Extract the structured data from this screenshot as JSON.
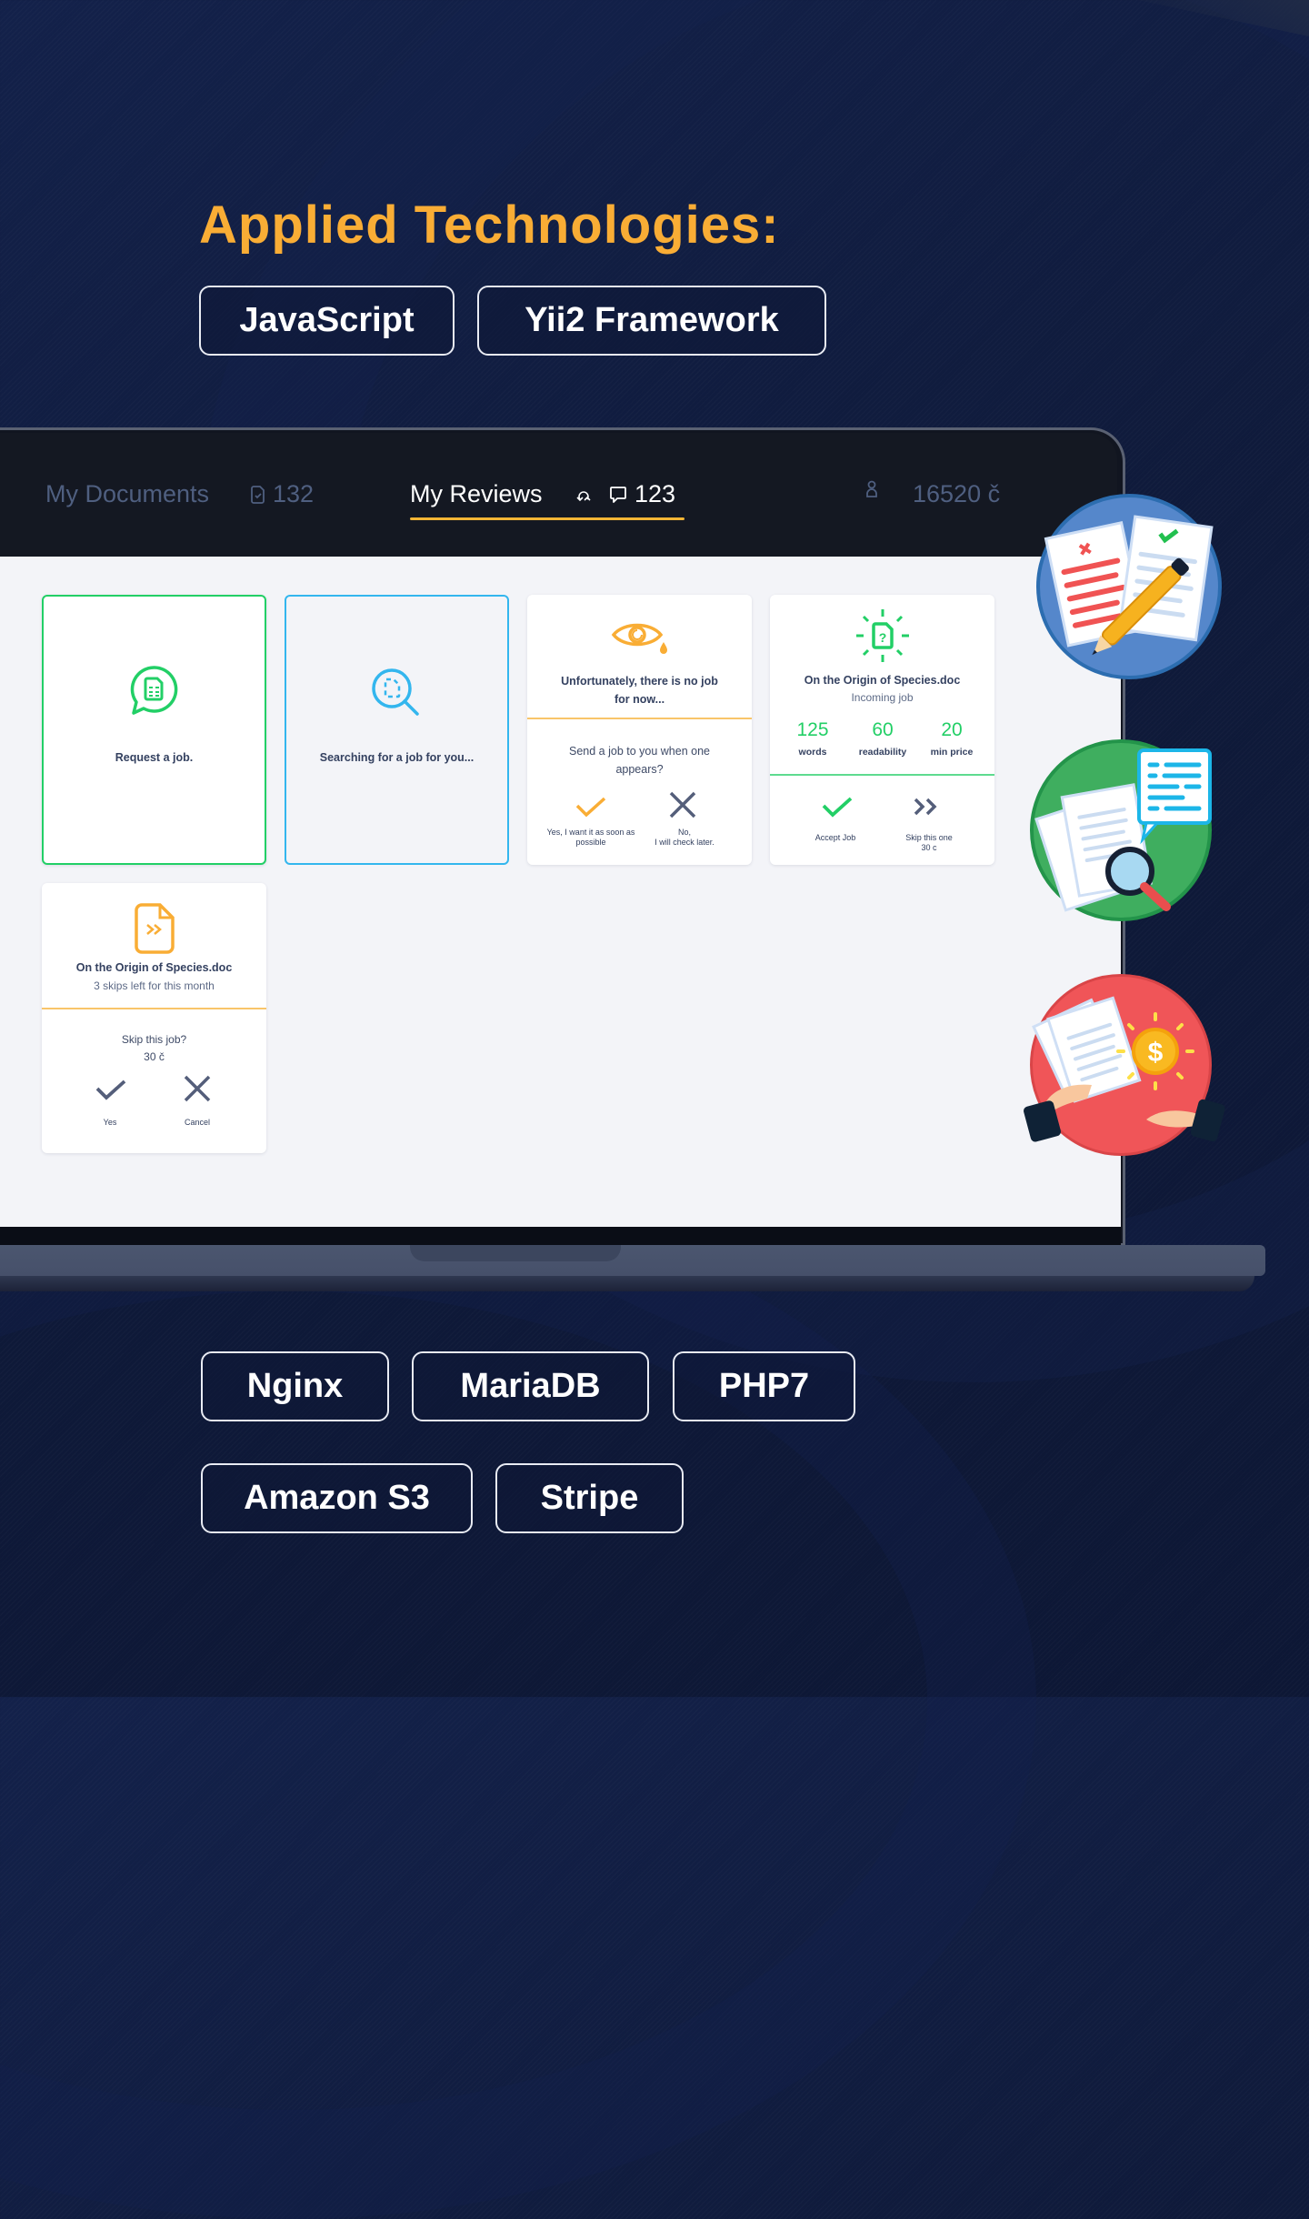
{
  "heading": "Applied Technologies:",
  "top_technologies": [
    "JavaScript",
    "Yii2 Framework"
  ],
  "bottom_technologies": [
    "Nginx",
    "MariaDB",
    "PHP7",
    "Amazon S3",
    "Stripe"
  ],
  "colors": {
    "accent_orange": "#f9ad35",
    "green": "#22cf66",
    "blue": "#33b6ee",
    "nav_underline": "#f2b535",
    "background": "#101b3a"
  },
  "app": {
    "nav": {
      "documents_label": "My Documents",
      "documents_count": "132",
      "reviews_label": "My Reviews",
      "reviews_count": "123",
      "balance": "16520 č",
      "active_tab": "My Reviews"
    },
    "cards": {
      "request": {
        "label": "Request a job."
      },
      "searching": {
        "label": "Searching for a job for you..."
      },
      "no_job": {
        "title": "Unfortunately, there is no job for now...",
        "question": "Send a job to you when one appears?",
        "yes_label": "Yes, I want it as soon as possible",
        "no_label_line1": "No,",
        "no_label_line2": "I will check later."
      },
      "incoming": {
        "filename": "On the Origin of Species.doc",
        "status": "Incoming job",
        "stats": [
          {
            "value": "125",
            "label": "words"
          },
          {
            "value": "60",
            "label": "readability"
          },
          {
            "value": "20",
            "label": "min price"
          }
        ],
        "accept_label": "Accept Job",
        "skip_label_line1": "Skip this one",
        "skip_label_line2": "30 c"
      },
      "skip": {
        "filename": "On the Origin of Species.doc",
        "skips_left": "3 skips left for this month",
        "question": "Skip this job?",
        "cost": "30 č",
        "yes_label": "Yes",
        "cancel_label": "Cancel"
      }
    }
  },
  "illustrations": [
    "document-review-illustration",
    "document-search-illustration",
    "payment-exchange-illustration"
  ]
}
